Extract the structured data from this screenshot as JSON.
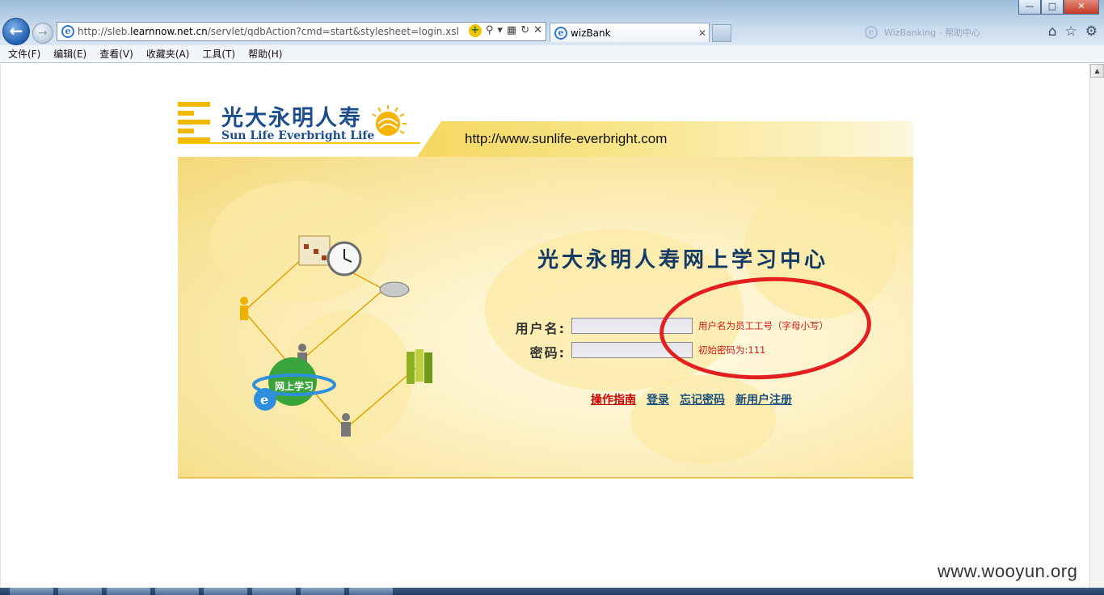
{
  "browser": {
    "address": "http://sleb.learnnow.net.cn/servlet/qdbAction?cmd=start&stylesheet=login.xsl",
    "address_prefix": "http://sleb.",
    "address_host": "learnnow.net.cn",
    "address_suffix": "/servlet/qdbAction?cmd=start&stylesheet=login.xsl",
    "tab_title": "wizBank",
    "inactive_tab_text": "WizBanking - 帮助中心",
    "menu": [
      "文件(F)",
      "编辑(E)",
      "查看(V)",
      "收藏夹(A)",
      "工具(T)",
      "帮助(H)"
    ]
  },
  "page": {
    "logo_cn": "光大永明人寿",
    "logo_en": "Sun Life Everbright Life",
    "site_url": "http://www.sunlife-everbright.com",
    "title": "光大永明人寿网上学习中心",
    "illustration_label": "网上学习",
    "form": {
      "username_label": "用户名:",
      "password_label": "密码:",
      "username_value": "",
      "password_value": "",
      "username_hint": "用户名为员工工号（字母小写）",
      "password_hint": "初始密码为:111"
    },
    "links": {
      "guide": "操作指南",
      "login": "登录",
      "forgot": "忘记密码",
      "register": "新用户注册"
    }
  },
  "watermark": "www.wooyun.org",
  "colors": {
    "brand_yellow": "#f2b800",
    "brand_blue": "#1c4d8d",
    "hint_red": "#cc1a1a",
    "annotation_red": "#e41f1f",
    "link_red": "#cc0000",
    "link_blue": "#1a4f7d"
  },
  "icons": {
    "back": "arrow-left-icon",
    "forward": "arrow-right-icon",
    "home": "home-icon",
    "favorites": "star-icon",
    "tools": "gear-icon"
  }
}
